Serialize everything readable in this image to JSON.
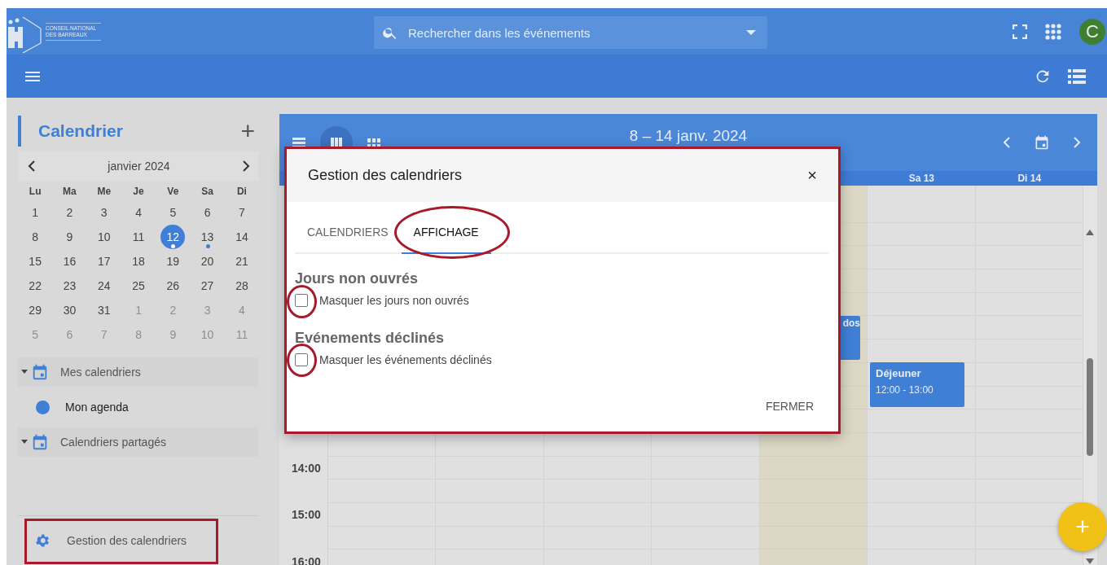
{
  "header": {
    "logo_lines": [
      "CONSEIL NATIONAL",
      "DES BARREAUX"
    ],
    "search": {
      "placeholder": "Rechercher dans les événements"
    },
    "avatar": "C"
  },
  "sidebar": {
    "title": "Calendrier",
    "add": "+",
    "month": "janvier 2024",
    "weekdays": [
      "Lu",
      "Ma",
      "Me",
      "Je",
      "Ve",
      "Sa",
      "Di"
    ],
    "days": [
      {
        "label": "1",
        "outside": false,
        "selected": false,
        "has_event": false
      },
      {
        "label": "2",
        "outside": false,
        "selected": false,
        "has_event": false
      },
      {
        "label": "3",
        "outside": false,
        "selected": false,
        "has_event": false
      },
      {
        "label": "4",
        "outside": false,
        "selected": false,
        "has_event": false
      },
      {
        "label": "5",
        "outside": false,
        "selected": false,
        "has_event": false
      },
      {
        "label": "6",
        "outside": false,
        "selected": false,
        "has_event": false
      },
      {
        "label": "7",
        "outside": false,
        "selected": false,
        "has_event": false
      },
      {
        "label": "8",
        "outside": false,
        "selected": false,
        "has_event": false
      },
      {
        "label": "9",
        "outside": false,
        "selected": false,
        "has_event": false
      },
      {
        "label": "10",
        "outside": false,
        "selected": false,
        "has_event": false
      },
      {
        "label": "11",
        "outside": false,
        "selected": false,
        "has_event": false
      },
      {
        "label": "12",
        "outside": false,
        "selected": true,
        "has_event": true
      },
      {
        "label": "13",
        "outside": false,
        "selected": false,
        "has_event": true
      },
      {
        "label": "14",
        "outside": false,
        "selected": false,
        "has_event": false
      },
      {
        "label": "15",
        "outside": false,
        "selected": false,
        "has_event": false
      },
      {
        "label": "16",
        "outside": false,
        "selected": false,
        "has_event": false
      },
      {
        "label": "17",
        "outside": false,
        "selected": false,
        "has_event": false
      },
      {
        "label": "18",
        "outside": false,
        "selected": false,
        "has_event": false
      },
      {
        "label": "19",
        "outside": false,
        "selected": false,
        "has_event": false
      },
      {
        "label": "20",
        "outside": false,
        "selected": false,
        "has_event": false
      },
      {
        "label": "21",
        "outside": false,
        "selected": false,
        "has_event": false
      },
      {
        "label": "22",
        "outside": false,
        "selected": false,
        "has_event": false
      },
      {
        "label": "23",
        "outside": false,
        "selected": false,
        "has_event": false
      },
      {
        "label": "24",
        "outside": false,
        "selected": false,
        "has_event": false
      },
      {
        "label": "25",
        "outside": false,
        "selected": false,
        "has_event": false
      },
      {
        "label": "26",
        "outside": false,
        "selected": false,
        "has_event": false
      },
      {
        "label": "27",
        "outside": false,
        "selected": false,
        "has_event": false
      },
      {
        "label": "28",
        "outside": false,
        "selected": false,
        "has_event": false
      },
      {
        "label": "29",
        "outside": false,
        "selected": false,
        "has_event": false
      },
      {
        "label": "30",
        "outside": false,
        "selected": false,
        "has_event": false
      },
      {
        "label": "31",
        "outside": false,
        "selected": false,
        "has_event": false
      },
      {
        "label": "1",
        "outside": true,
        "selected": false,
        "has_event": false
      },
      {
        "label": "2",
        "outside": true,
        "selected": false,
        "has_event": false
      },
      {
        "label": "3",
        "outside": true,
        "selected": false,
        "has_event": false
      },
      {
        "label": "4",
        "outside": true,
        "selected": false,
        "has_event": false
      },
      {
        "label": "5",
        "outside": true,
        "selected": false,
        "has_event": false
      },
      {
        "label": "6",
        "outside": true,
        "selected": false,
        "has_event": false
      },
      {
        "label": "7",
        "outside": true,
        "selected": false,
        "has_event": false
      },
      {
        "label": "8",
        "outside": true,
        "selected": false,
        "has_event": false
      },
      {
        "label": "9",
        "outside": true,
        "selected": false,
        "has_event": false
      },
      {
        "label": "10",
        "outside": true,
        "selected": false,
        "has_event": false
      },
      {
        "label": "11",
        "outside": true,
        "selected": false,
        "has_event": false
      }
    ],
    "groups": [
      {
        "label": "Mes calendriers",
        "expanded": true,
        "items": [
          {
            "label": "Mon agenda",
            "color": "#3f7fd6"
          }
        ]
      },
      {
        "label": "Calendriers partagés",
        "expanded": true
      }
    ],
    "settings_link": "Gestion des calendriers"
  },
  "calendar": {
    "range": "8 – 14 janv. 2024",
    "views": [
      {
        "kind": "day",
        "selected": false
      },
      {
        "kind": "week",
        "selected": true
      },
      {
        "kind": "month",
        "selected": false
      }
    ],
    "columns": [
      {
        "today": false
      },
      {
        "today": false
      },
      {
        "today": false
      },
      {
        "today": false
      },
      {
        "today": true
      },
      {
        "label": "Sa 13",
        "today": false
      },
      {
        "label": "Di 14",
        "today": false
      }
    ],
    "times": [
      "14:00",
      "15:00",
      "16:00"
    ],
    "events": [
      {
        "title": "dos"
      },
      {
        "title": "Déjeuner",
        "time": "12:00 - 13:00"
      }
    ],
    "fab": "+"
  },
  "dialog": {
    "title": "Gestion des calendriers",
    "close": "×",
    "tabs": [
      {
        "label": "CALENDRIERS",
        "selected": false
      },
      {
        "label": "AFFICHAGE",
        "selected": true
      }
    ],
    "sections": [
      {
        "heading": "Jours non ouvrés",
        "option": {
          "label": "Masquer les jours non ouvrés",
          "checked": false
        }
      },
      {
        "heading": "Evénements déclinés",
        "option": {
          "label": "Masquer les événements déclinés",
          "checked": false
        }
      }
    ],
    "close_button": "FERMER"
  },
  "annotations": [
    {
      "kind": "frame"
    },
    {
      "kind": "ellipse"
    },
    {
      "kind": "circle"
    },
    {
      "kind": "circle"
    },
    {
      "kind": "frame"
    }
  ]
}
